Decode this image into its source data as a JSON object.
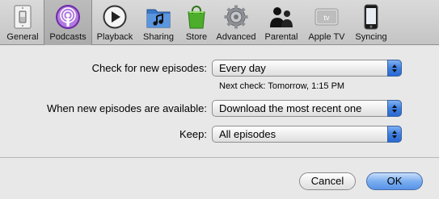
{
  "toolbar": {
    "items": [
      {
        "label": "General",
        "icon": "light-switch-icon",
        "selected": false
      },
      {
        "label": "Podcasts",
        "icon": "podcast-icon",
        "selected": true
      },
      {
        "label": "Playback",
        "icon": "play-icon",
        "selected": false
      },
      {
        "label": "Sharing",
        "icon": "music-folder-icon",
        "selected": false
      },
      {
        "label": "Store",
        "icon": "shopping-bag-icon",
        "selected": false
      },
      {
        "label": "Advanced",
        "icon": "gear-icon",
        "selected": false
      },
      {
        "label": "Parental",
        "icon": "parents-icon",
        "selected": false
      },
      {
        "label": "Apple TV",
        "icon": "apple-tv-icon",
        "selected": false
      },
      {
        "label": "Syncing",
        "icon": "iphone-icon",
        "selected": false
      }
    ]
  },
  "settings": {
    "check_label": "Check for new episodes:",
    "check_value": "Every day",
    "next_check": "Next check: Tomorrow, 1:15 PM",
    "available_label": "When new episodes are available:",
    "available_value": "Download the most recent one",
    "keep_label": "Keep:",
    "keep_value": "All episodes"
  },
  "buttons": {
    "cancel": "Cancel",
    "ok": "OK"
  },
  "colors": {
    "accent_blue": "#3f7fe0",
    "podcast_purple": "#9b4fd1",
    "store_green": "#4cae2a"
  }
}
